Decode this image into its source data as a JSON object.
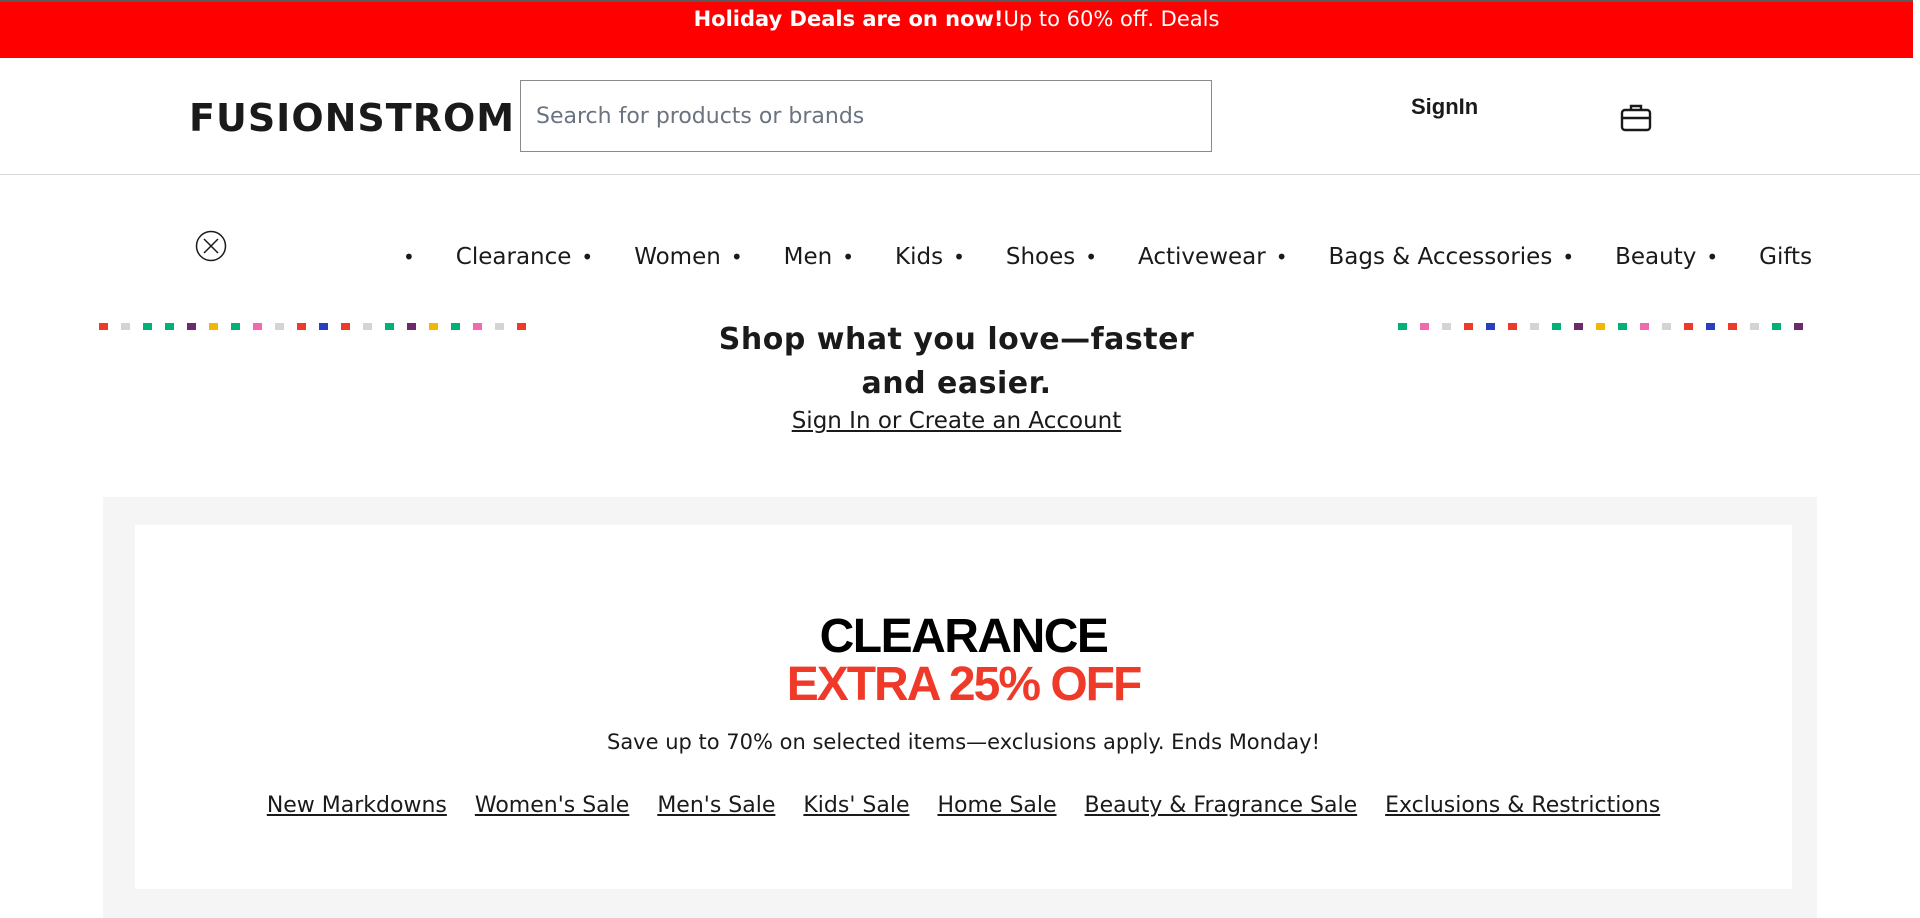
{
  "banner": {
    "strong": "Holiday Deals are on now!",
    "rest": "Up to 60% off. Deals",
    "color": "#ff0000"
  },
  "header": {
    "logo": "FUSIONSTROM",
    "search_placeholder": "Search for products or brands",
    "signin_label": "SignIn",
    "bag_icon": "shopping-bag-icon"
  },
  "nav": {
    "close_icon": "close-circle-icon",
    "items": [
      "Clearance",
      "Women",
      "Men",
      "Kids",
      "Shoes",
      "Activewear",
      "Bags & Accessories",
      "Beauty",
      "Gifts"
    ],
    "separator": "•"
  },
  "promo": {
    "title": "Shop what you love—faster and easier.",
    "link": "Sign In or Create an Account",
    "confetti_left": [
      "#ef3a2a",
      "#d4d4d4",
      "#00b373",
      "#00b373",
      "#6b2a6b",
      "#f2b705",
      "#00b373",
      "#f06ab0",
      "#d4d4d4",
      "#ef3a2a",
      "#2a3fbf",
      "#ef3a2a",
      "#d4d4d4",
      "#00b373",
      "#6b2a6b",
      "#f2b705",
      "#00b373",
      "#f06ab0",
      "#d4d4d4",
      "#ef3a2a"
    ],
    "confetti_right": [
      "#00b373",
      "#f06ab0",
      "#d4d4d4",
      "#ef3a2a",
      "#2a3fbf",
      "#ef3a2a",
      "#d4d4d4",
      "#00b373",
      "#6b2a6b",
      "#f2b705",
      "#00b373",
      "#f06ab0",
      "#d4d4d4",
      "#ef3a2a",
      "#2a3fbf",
      "#ef3a2a",
      "#d4d4d4",
      "#00b373",
      "#6b2a6b"
    ]
  },
  "clearance": {
    "line1": "CLEARANCE",
    "line2": "EXTRA 25% OFF",
    "accent_color": "#ef3a2a",
    "description": "Save up to 70% on selected items—exclusions apply. Ends Monday!",
    "links": [
      "New Markdowns",
      "Women's Sale",
      "Men's Sale",
      "Kids' Sale",
      "Home Sale",
      "Beauty & Fragrance Sale",
      "Exclusions & Restrictions"
    ]
  }
}
